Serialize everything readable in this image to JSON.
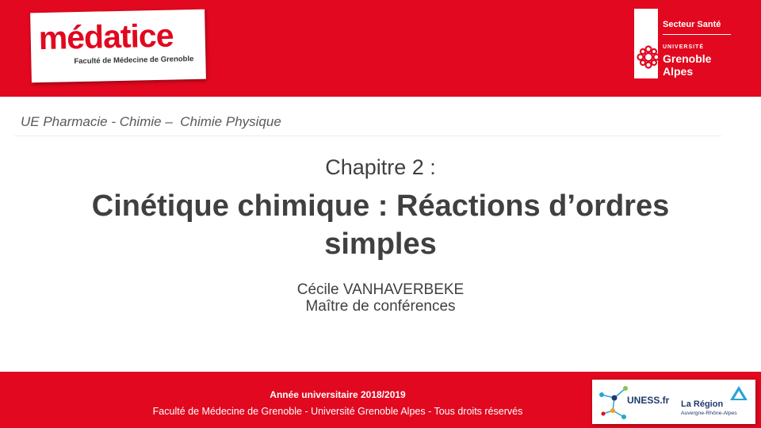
{
  "header": {
    "logo_word": "médatice",
    "logo_subtitle": "Faculté de Médecine de Grenoble",
    "secteur": "Secteur Santé",
    "universite": "UNIVERSITÉ",
    "grenoble": "Grenoble",
    "alpes": "Alpes",
    "brand_color": "#e1081f"
  },
  "slide": {
    "ue_line": "UE Pharmacie - Chimie –  Chimie Physique",
    "chapter": "Chapitre 2 :",
    "title_line1": "Cinétique chimique : Réactions d’ordres",
    "title_line2": "simples",
    "author": "Cécile VANHAVERBEKE",
    "author_role": "Maître de conférences"
  },
  "footer": {
    "year": "Année universitaire 2018/2019",
    "rights": "Faculté de Médecine de Grenoble - Université Grenoble Alpes - Tous droits réservés",
    "uness": "UNESS.fr",
    "region": "La Région",
    "region_sub": "Auvergne-Rhône-Alpes"
  }
}
